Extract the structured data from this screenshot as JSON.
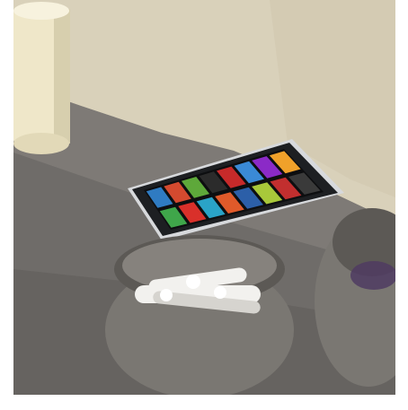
{
  "scene": {
    "description_free": true,
    "colors": {
      "frame_white": "#ffffff",
      "wall": "#d9d1ba",
      "wall_shadow": "#c7bea7",
      "table": "#6f6c69",
      "table_light": "#8a8782",
      "table_dark": "#55534f",
      "cup": "#efe7c9",
      "cup_shadow": "#d7cfae",
      "phone_body": "#1d1f22",
      "phone_bezel": "#d7d9dc",
      "bowl": "#7a7772",
      "bowl_dark": "#5c5955",
      "bowl_light": "#a29e97",
      "cotton": "#f2f1ee",
      "cotton_shadow": "#d6d4cf",
      "moss": "#4f3b62"
    },
    "tiles": [
      {
        "color": "#2f7bc2"
      },
      {
        "color": "#d44a2f"
      },
      {
        "color": "#5ea83a"
      },
      {
        "color": "#2b2b2b"
      },
      {
        "color": "#c72a2a"
      },
      {
        "color": "#3a8ad6"
      },
      {
        "color": "#8b2ac7"
      },
      {
        "color": "#f0a12a"
      },
      {
        "color": "#3fa64a"
      },
      {
        "color": "#d9302a"
      },
      {
        "color": "#2aa3c7"
      },
      {
        "color": "#e05a2a"
      },
      {
        "color": "#2c5fa8"
      },
      {
        "color": "#a8c83a"
      },
      {
        "color": "#c22f2f"
      },
      {
        "color": "#3a3a3a"
      }
    ]
  }
}
